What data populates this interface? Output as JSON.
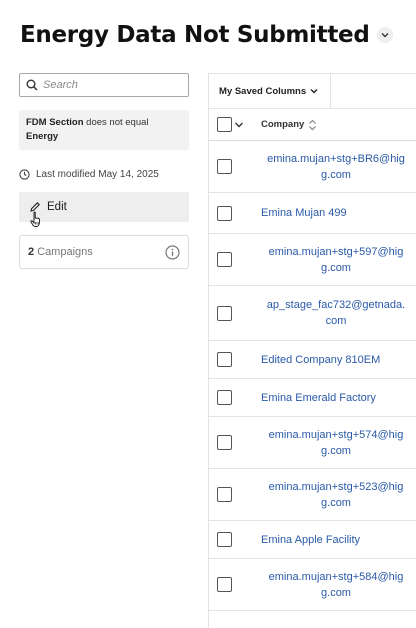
{
  "page": {
    "title": "Energy Data Not Submitted"
  },
  "sidebar": {
    "search_placeholder": "Search",
    "filter": {
      "field": "FDM Section",
      "operator": "does not equal",
      "value": "Energy"
    },
    "last_modified": "Last modified May 14, 2025",
    "edit_label": "Edit",
    "campaigns_count": "2",
    "campaigns_label": "Campaigns"
  },
  "grid": {
    "saved_columns_label": "My Saved Columns",
    "company_header": "Company",
    "rows": [
      {
        "line1": "emina.mujan+stg+BR6@hig",
        "line2": "g.com"
      },
      {
        "line1": "Emina Mujan 499",
        "line2": ""
      },
      {
        "line1": "emina.mujan+stg+597@hig",
        "line2": "g.com"
      },
      {
        "line1": "ap_stage_fac732@getnada.",
        "line2": "com"
      },
      {
        "line1": "Edited Company 810EM",
        "line2": ""
      },
      {
        "line1": "Emina Emerald Factory",
        "line2": ""
      },
      {
        "line1": "emina.mujan+stg+574@hig",
        "line2": "g.com"
      },
      {
        "line1": "emina.mujan+stg+523@hig",
        "line2": "g.com"
      },
      {
        "line1": "Emina Apple Facility",
        "line2": ""
      },
      {
        "line1": "emina.mujan+stg+584@hig",
        "line2": "g.com"
      }
    ]
  },
  "colors": {
    "link": "#2a5aa8",
    "panel": "#f2f2f2"
  }
}
